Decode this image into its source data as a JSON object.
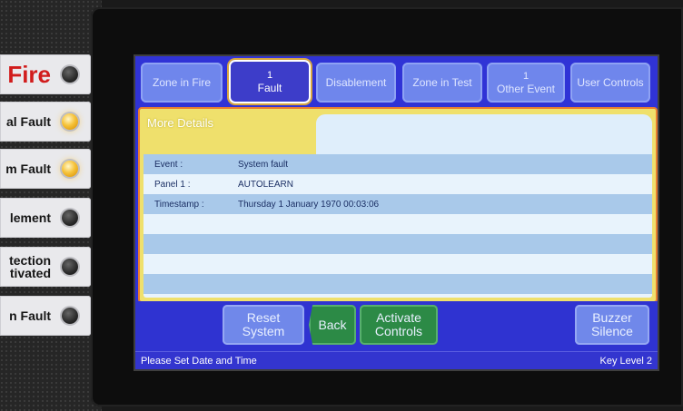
{
  "panel": {
    "indicators": [
      {
        "label": "Fire",
        "lit": false
      },
      {
        "label": "al Fault",
        "lit": true
      },
      {
        "label": "m Fault",
        "lit": true
      },
      {
        "label": "lement",
        "lit": false
      },
      {
        "label_line1": "tection",
        "label_line2": "tivated",
        "lit": false
      },
      {
        "label": "n Fault",
        "lit": false
      }
    ]
  },
  "tabs": [
    {
      "label": "Zone in Fire"
    },
    {
      "count": "1",
      "label": "Fault",
      "active": true
    },
    {
      "label": "Disablement"
    },
    {
      "label": "Zone in Test"
    },
    {
      "count": "1",
      "label": "Other Event"
    },
    {
      "label": "User Controls"
    }
  ],
  "details": {
    "title": "More Details",
    "rows": [
      {
        "key": "Event :",
        "value": "System fault"
      },
      {
        "key": "Panel 1 :",
        "value": "AUTOLEARN"
      },
      {
        "key": "Timestamp :",
        "value": "Thursday 1 January 1970 00:03:06"
      }
    ]
  },
  "buttons": {
    "reset_line1": "Reset",
    "reset_line2": "System",
    "back": "Back",
    "activate_line1": "Activate",
    "activate_line2": "Controls",
    "buzzer_line1": "Buzzer",
    "buzzer_line2": "Silence"
  },
  "status": {
    "message": "Please Set Date and Time",
    "key_level": "Key Level 2"
  },
  "colors": {
    "screen_bg": "#3033d6",
    "tab": "#6f86ec",
    "details_header": "#efe06c",
    "green_button": "#2c8a46",
    "led_on": "#f6c33a"
  }
}
